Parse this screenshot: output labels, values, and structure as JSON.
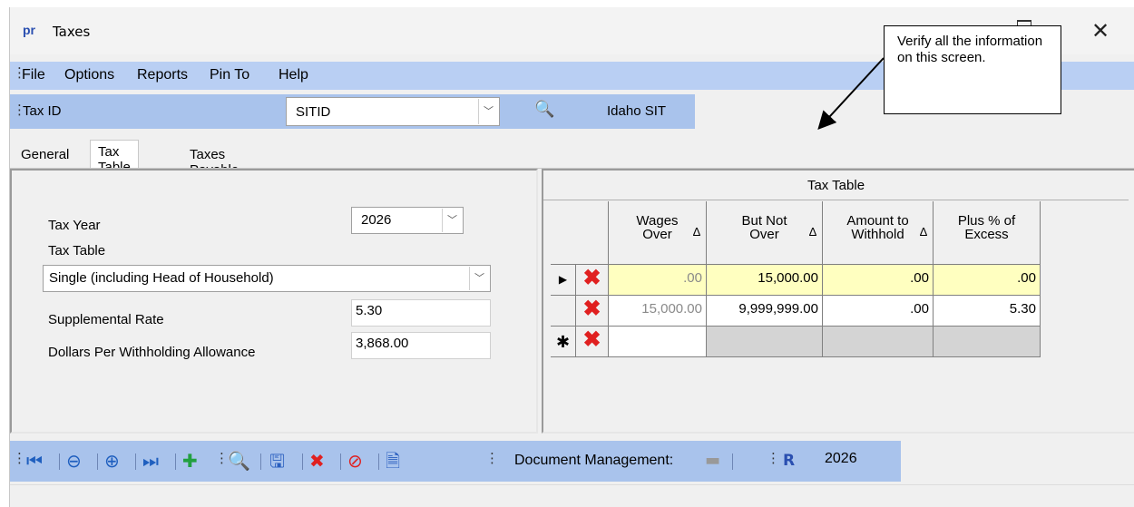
{
  "window": {
    "app_icon_text": "pr",
    "title": "Taxes"
  },
  "menu": [
    "File",
    "Options",
    "Reports",
    "Pin To",
    "Help"
  ],
  "taxid_bar": {
    "label": "Tax ID",
    "value": "SITID",
    "name": "Idaho SIT"
  },
  "tabs": [
    "General",
    "Tax Table",
    "Taxes Payable"
  ],
  "form": {
    "tax_year_label": "Tax Year",
    "tax_year_value": "2026",
    "tax_table_label": "Tax Table",
    "tax_table_value": "Single (including Head of Household)",
    "supplemental_label": "Supplemental Rate",
    "supplemental_value": "5.30",
    "dollars_label": "Dollars Per Withholding Allowance",
    "dollars_value": "3,868.00"
  },
  "grid": {
    "title": "Tax Table",
    "columns": [
      "Wages\nOver",
      "But Not\nOver",
      "Amount to\nWithhold",
      "Plus % of\nExcess"
    ],
    "rows": [
      {
        "wages_over": ".00",
        "but_not_over": "15,000.00",
        "amount": ".00",
        "plus": ".00"
      },
      {
        "wages_over": "15,000.00",
        "but_not_over": "9,999,999.00",
        "amount": ".00",
        "plus": "5.30"
      }
    ]
  },
  "bottom": {
    "doc_label": "Document Management:",
    "year": "2026"
  },
  "callout": "Verify all the information on this screen.",
  "colors": {
    "menubar": "#b9cff3",
    "toolbar": "#a9c3ec",
    "highlight": "#ffffc0",
    "delete": "#e02020"
  }
}
